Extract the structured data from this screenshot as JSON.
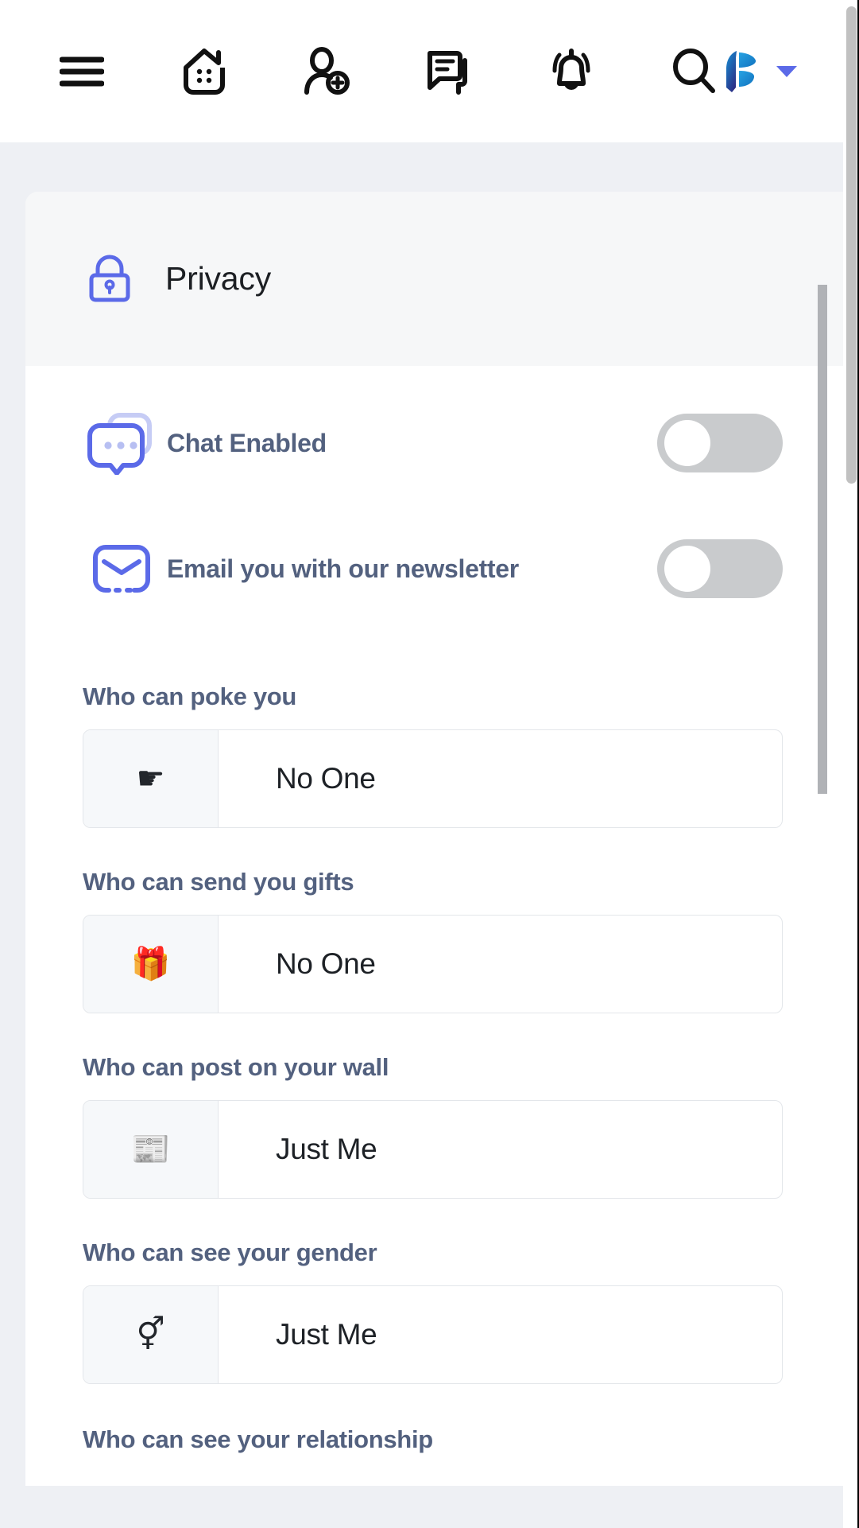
{
  "topnav": {
    "items": [
      {
        "name": "menu-icon",
        "label": "Menu"
      },
      {
        "name": "home-icon",
        "label": "Home"
      },
      {
        "name": "add-friend-icon",
        "label": "Add Friend"
      },
      {
        "name": "messages-icon",
        "label": "Messages"
      },
      {
        "name": "notifications-icon",
        "label": "Notifications"
      },
      {
        "name": "search-icon",
        "label": "Search"
      }
    ],
    "brand": {
      "name": "brand-logo",
      "label": "Peepso"
    },
    "caret": {
      "name": "chevron-down-icon",
      "label": "Account menu"
    }
  },
  "card": {
    "header": {
      "icon": "lock-icon",
      "title": "Privacy"
    },
    "toggles": [
      {
        "icon": "chat-bubbles-icon",
        "label": "Chat Enabled",
        "state": "off"
      },
      {
        "icon": "envelope-icon",
        "label": "Email you with our newsletter",
        "state": "off"
      }
    ],
    "fields": [
      {
        "label": "Who can poke you",
        "icon": "pointing-hand-icon",
        "icon_glyph": "☛",
        "value": "No One"
      },
      {
        "label": "Who can send you gifts",
        "icon": "gift-icon",
        "icon_glyph": "🎁",
        "value": "No One"
      },
      {
        "label": "Who can post on your wall",
        "icon": "newspaper-icon",
        "icon_glyph": "📰",
        "value": "Just Me"
      },
      {
        "label": "Who can see your gender",
        "icon": "gender-symbols-icon",
        "icon_glyph": "⚥",
        "value": "Just Me"
      }
    ],
    "cut_off_label": "Who can see your relationship"
  },
  "colors": {
    "accent": "#5b6ae8",
    "label_text": "#53617f",
    "page_bg": "#eef0f4",
    "card_header_bg": "#f6f7f8",
    "toggle_off_track": "#c9cbcd",
    "addon_bg": "#f6f8fa",
    "border": "#e3e6ea"
  }
}
